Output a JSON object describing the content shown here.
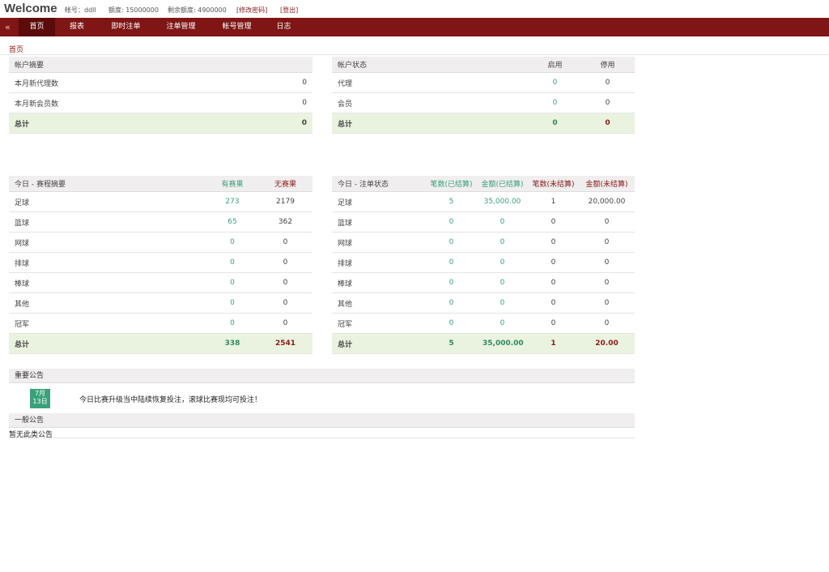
{
  "header": {
    "welcome": "Welcome",
    "account": "帐号：ddll",
    "quota": "额度: 15000000",
    "remaining_quota": "剩余额度: 4900000",
    "change_password": "[修改密码]",
    "logout": "[登出]"
  },
  "nav": {
    "collapse_icon": "«",
    "items": [
      "首页",
      "报表",
      "即时注单",
      "注单管理",
      "帐号管理",
      "日志"
    ],
    "active": "首页"
  },
  "breadcrumb": "首页",
  "account_summary": {
    "title": "帐户摘要",
    "rows": [
      {
        "label": "本月新代理数",
        "value": "0"
      },
      {
        "label": "本月新会员数",
        "value": "0"
      }
    ],
    "total": {
      "label": "总计",
      "value": "0"
    }
  },
  "account_status": {
    "title": "帐户状态",
    "col_enabled": "启用",
    "col_disabled": "停用",
    "rows": [
      {
        "label": "代理",
        "enabled": "0",
        "disabled": "0"
      },
      {
        "label": "会员",
        "enabled": "0",
        "disabled": "0"
      }
    ],
    "total": {
      "label": "总计",
      "enabled": "0",
      "disabled": "0"
    }
  },
  "match_summary": {
    "title": "今日 - 赛程摘要",
    "col_with_result": "有赛果",
    "col_no_result": "无赛果",
    "rows": [
      {
        "label": "足球",
        "with": "273",
        "without": "2179"
      },
      {
        "label": "篮球",
        "with": "65",
        "without": "362"
      },
      {
        "label": "网球",
        "with": "0",
        "without": "0"
      },
      {
        "label": "排球",
        "with": "0",
        "without": "0"
      },
      {
        "label": "棒球",
        "with": "0",
        "without": "0"
      },
      {
        "label": "其他",
        "with": "0",
        "without": "0"
      },
      {
        "label": "冠军",
        "with": "0",
        "without": "0"
      }
    ],
    "total": {
      "label": "总计",
      "with": "338",
      "without": "2541"
    }
  },
  "bet_status": {
    "title": "今日 - 注单状态",
    "col_count_settled": "笔数(已结算)",
    "col_amount_settled": "金额(已结算)",
    "col_count_unsettled": "笔数(未结算)",
    "col_amount_unsettled": "金额(未结算)",
    "rows": [
      {
        "label": "足球",
        "cs": "5",
        "as": "35,000.00",
        "cu": "1",
        "au": "20,000.00"
      },
      {
        "label": "篮球",
        "cs": "0",
        "as": "0",
        "cu": "0",
        "au": "0"
      },
      {
        "label": "网球",
        "cs": "0",
        "as": "0",
        "cu": "0",
        "au": "0"
      },
      {
        "label": "排球",
        "cs": "0",
        "as": "0",
        "cu": "0",
        "au": "0"
      },
      {
        "label": "棒球",
        "cs": "0",
        "as": "0",
        "cu": "0",
        "au": "0"
      },
      {
        "label": "其他",
        "cs": "0",
        "as": "0",
        "cu": "0",
        "au": "0"
      },
      {
        "label": "冠军",
        "cs": "0",
        "as": "0",
        "cu": "0",
        "au": "0"
      }
    ],
    "total": {
      "label": "总计",
      "cs": "5",
      "as": "35,000.00",
      "cu": "1",
      "au": "20.00"
    }
  },
  "important_notice": {
    "title": "重要公告",
    "date_month": "7月",
    "date_day": "13日",
    "text": "今日比赛升级当中陆续恢复投注，滚球比赛现均可投注！"
  },
  "general_notice": {
    "title": "一般公告",
    "empty_text": "暂无此类公告"
  },
  "colors": {
    "nav_bg": "#7f1515",
    "nav_active": "#5c0b0b",
    "accent_green": "#3aa17a",
    "accent_red": "#8a1c1c",
    "total_row_bg": "#eaf3df"
  }
}
